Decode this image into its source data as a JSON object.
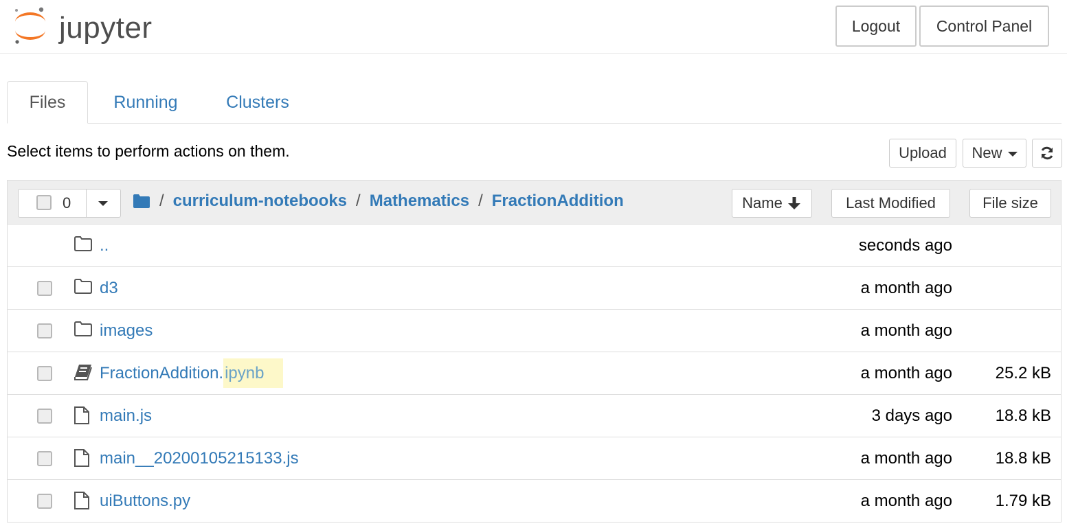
{
  "header": {
    "logo_text": "jupyter",
    "logout_label": "Logout",
    "control_panel_label": "Control Panel"
  },
  "tabs": [
    {
      "label": "Files",
      "active": true
    },
    {
      "label": "Running",
      "active": false
    },
    {
      "label": "Clusters",
      "active": false
    }
  ],
  "toolbar": {
    "message": "Select items to perform actions on them.",
    "upload_label": "Upload",
    "new_label": "New"
  },
  "list_header": {
    "selected_count": "0",
    "breadcrumb": [
      "curriculum-notebooks",
      "Mathematics",
      "FractionAddition"
    ],
    "sort_name_label": "Name",
    "sort_modified_label": "Last Modified",
    "sort_size_label": "File size"
  },
  "files": [
    {
      "name": "..",
      "ext": "",
      "type": "folder",
      "modified": "seconds ago",
      "size": "",
      "checkbox": false
    },
    {
      "name": "d3",
      "ext": "",
      "type": "folder",
      "modified": "a month ago",
      "size": "",
      "checkbox": true
    },
    {
      "name": "images",
      "ext": "",
      "type": "folder",
      "modified": "a month ago",
      "size": "",
      "checkbox": true
    },
    {
      "name": "FractionAddition.",
      "ext": "ipynb",
      "type": "notebook",
      "modified": "a month ago",
      "size": "25.2 kB",
      "checkbox": true
    },
    {
      "name": "main.js",
      "ext": "",
      "type": "file",
      "modified": "3 days ago",
      "size": "18.8 kB",
      "checkbox": true
    },
    {
      "name": "main__20200105215133.js",
      "ext": "",
      "type": "file",
      "modified": "a month ago",
      "size": "18.8 kB",
      "checkbox": true
    },
    {
      "name": "uiButtons.py",
      "ext": "",
      "type": "file",
      "modified": "a month ago",
      "size": "1.79 kB",
      "checkbox": true
    }
  ],
  "colors": {
    "link": "#337ab7",
    "logo_orange": "#f37726",
    "header_bg": "#eeeeee"
  }
}
